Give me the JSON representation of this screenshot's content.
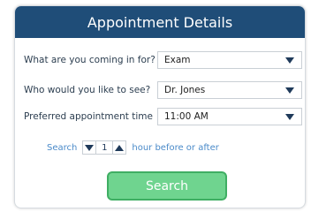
{
  "header": {
    "title": "Appointment Details"
  },
  "fields": [
    {
      "label": "What are you coming in for?",
      "value": "Exam"
    },
    {
      "label": "Who would you like to see?",
      "value": "Dr. Jones"
    },
    {
      "label": "Preferred appointment time",
      "value": "11:00 AM"
    }
  ],
  "search_range": {
    "prefix": "Search",
    "value": "1",
    "suffix": "hour before or after"
  },
  "search_button": {
    "label": "Search"
  },
  "colors": {
    "header_bg": "#1f4d78",
    "button_bg": "#6fd48f",
    "button_border": "#3fae63",
    "link_text": "#4a8ac9"
  }
}
